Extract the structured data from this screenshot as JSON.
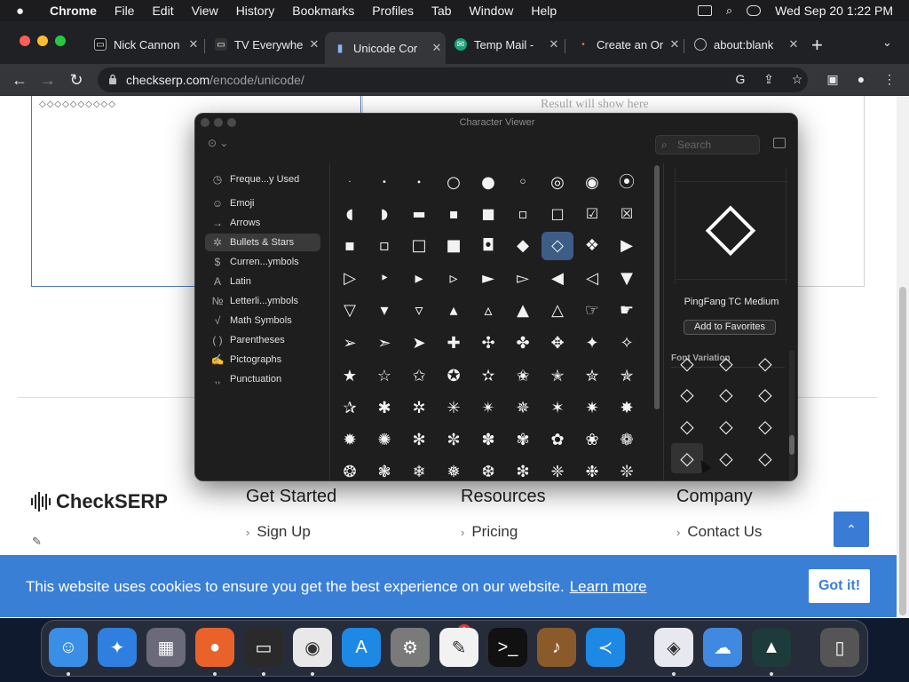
{
  "menubar": {
    "app": "Chrome",
    "items": [
      "File",
      "Edit",
      "View",
      "History",
      "Bookmarks",
      "Profiles",
      "Tab",
      "Window",
      "Help"
    ],
    "datetime": "Wed Sep 20  1:22 PM"
  },
  "tabs": [
    {
      "label": "Nick Cannon",
      "icon": "tv-icon"
    },
    {
      "label": "TV Everywhe",
      "icon": "tv-icon"
    },
    {
      "label": "Unicode Cor",
      "icon": "soundwave-icon"
    },
    {
      "label": "Temp Mail -",
      "icon": "mail-icon"
    },
    {
      "label": "Create an Or",
      "icon": "dot-icon"
    },
    {
      "label": "about:blank",
      "icon": "globe-icon"
    }
  ],
  "omnibox": {
    "domain": "checkserp.com",
    "path": "/encode/unicode/"
  },
  "page": {
    "input_value": "◇◇◇◇◇◇◇◇◇◇",
    "result_placeholder": "Result will show here"
  },
  "character_viewer": {
    "title": "Character Viewer",
    "search_placeholder": "Search",
    "categories": [
      {
        "label": "Freque...y Used",
        "icon": "clock-icon",
        "glyph": "◷"
      },
      {
        "label": "Emoji",
        "icon": "smiley-icon",
        "glyph": "☺"
      },
      {
        "label": "Arrows",
        "icon": "arrow-icon",
        "glyph": "→"
      },
      {
        "label": "Bullets & Stars",
        "icon": "star-icon",
        "glyph": "✲"
      },
      {
        "label": "Curren...ymbols",
        "icon": "dollar-icon",
        "glyph": "$"
      },
      {
        "label": "Latin",
        "icon": "latin-icon",
        "glyph": "A"
      },
      {
        "label": "Letterli...ymbols",
        "icon": "numero-icon",
        "glyph": "№"
      },
      {
        "label": "Math Symbols",
        "icon": "sqrt-icon",
        "glyph": "√"
      },
      {
        "label": "Parentheses",
        "icon": "paren-icon",
        "glyph": "( )"
      },
      {
        "label": "Pictographs",
        "icon": "pictograph-icon",
        "glyph": "✍"
      },
      {
        "label": "Punctuation",
        "icon": "punctuation-icon",
        "glyph": ",,"
      }
    ],
    "selected_category": 3,
    "grid": [
      [
        "·",
        "•",
        "∙",
        "○",
        "●",
        "◦",
        "◎",
        "◉",
        "⦿"
      ],
      [
        "◖",
        "◗",
        "▬",
        "▪",
        "■",
        "▫",
        "□",
        "☑",
        "☒"
      ],
      [
        "▪",
        "▫",
        "□",
        "■",
        "◘",
        "◆",
        "◇",
        "❖",
        "▶"
      ],
      [
        "▷",
        "‣",
        "▸",
        "▹",
        "►",
        "▻",
        "◀",
        "◁",
        "▼"
      ],
      [
        "▽",
        "▾",
        "▿",
        "▴",
        "▵",
        "▲",
        "△",
        "☞",
        "☛"
      ],
      [
        "➢",
        "➣",
        "➤",
        "✚",
        "✣",
        "✤",
        "✥",
        "✦",
        "✧"
      ],
      [
        "★",
        "☆",
        "✩",
        "✪",
        "✫",
        "✬",
        "✭",
        "✮",
        "✯"
      ],
      [
        "✰",
        "✱",
        "✲",
        "✳",
        "✴",
        "✵",
        "✶",
        "✷",
        "✸"
      ],
      [
        "✹",
        "✺",
        "✻",
        "✼",
        "✽",
        "✾",
        "✿",
        "❀",
        "❁"
      ],
      [
        "❂",
        "❃",
        "❄",
        "❅",
        "❆",
        "❇",
        "❈",
        "❉",
        "❊"
      ]
    ],
    "selected_glyph": "◇",
    "font_name": "PingFang TC Medium",
    "add_favorites": "Add to Favorites",
    "font_variation_label": "Font Variation",
    "variations": [
      "◇",
      "◇",
      "◇",
      "◇",
      "◇",
      "◇",
      "◇",
      "◇",
      "◇",
      "◇",
      "◇",
      "◇"
    ]
  },
  "footer": {
    "brand": "CheckSERP",
    "columns": [
      {
        "title": "Get Started",
        "link": "Sign Up"
      },
      {
        "title": "Resources",
        "link": "Pricing"
      },
      {
        "title": "Company",
        "link": "Contact Us"
      }
    ]
  },
  "cookie": {
    "message": "This website uses cookies to ensure you get the best experience on our website.",
    "learn_more": "Learn more",
    "button": "Got it!"
  },
  "dock": {
    "items": [
      {
        "name": "finder-icon",
        "color": "#3a8ee6",
        "glyph": "☺"
      },
      {
        "name": "safari-icon",
        "color": "#2f7fe0",
        "glyph": "✦"
      },
      {
        "name": "launchpad-icon",
        "color": "#6a6a7a",
        "glyph": "▦"
      },
      {
        "name": "firefox-icon",
        "color": "#e8622a",
        "glyph": "●"
      },
      {
        "name": "screen-icon",
        "color": "#2a2a2a",
        "glyph": "▭"
      },
      {
        "name": "chrome-icon",
        "color": "#e8e8e8",
        "glyph": "◉"
      },
      {
        "name": "appstore-icon",
        "color": "#1e88e5",
        "glyph": "A"
      },
      {
        "name": "settings-icon",
        "color": "#7a7a7a",
        "glyph": "⚙"
      },
      {
        "name": "textedit-icon",
        "color": "#f2f2f2",
        "glyph": "✎"
      },
      {
        "name": "terminal-icon",
        "color": "#111111",
        "glyph": ">_"
      },
      {
        "name": "guitar-icon",
        "color": "#8a5a2a",
        "glyph": "♪"
      },
      {
        "name": "vscode-icon",
        "color": "#1e88e5",
        "glyph": "≺"
      },
      {
        "name": "visualstudio-icon",
        "color": "#e8e8f0",
        "glyph": "◈"
      },
      {
        "name": "weather-icon",
        "color": "#3f8ae0",
        "glyph": "☁"
      },
      {
        "name": "filmora-icon",
        "color": "#1d3b3b",
        "glyph": "▲"
      },
      {
        "name": "trash-icon",
        "color": "#555555",
        "glyph": "▯"
      }
    ],
    "settings_badge": "1"
  }
}
